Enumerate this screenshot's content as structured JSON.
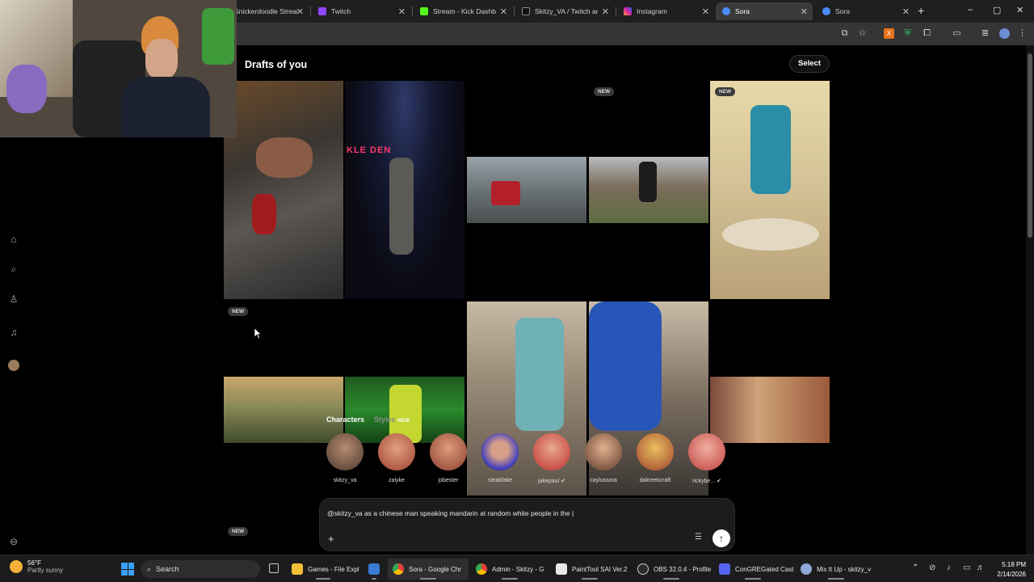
{
  "browser": {
    "tabs": [
      {
        "label": "Snickerdoodle Stream",
        "active": false
      },
      {
        "label": "Twitch",
        "active": false
      },
      {
        "label": "Stream - Kick Dashboard",
        "active": false
      },
      {
        "label": "Skitzy_VA / Twitch and",
        "active": false
      },
      {
        "label": "Instagram",
        "active": false
      },
      {
        "label": "Sora",
        "active": true
      },
      {
        "label": "Sora",
        "active": false
      }
    ],
    "new_tab": "+",
    "window_controls": [
      "–",
      "▢",
      "✕"
    ]
  },
  "sora": {
    "page_title": "Drafts of you",
    "select_label": "Select",
    "badge_new": "NEW",
    "characters_tab": "Characters",
    "styles_tab": "Styles",
    "styles_badge": "NEW",
    "characters": [
      {
        "name": "skitzy_va",
        "verified": false
      },
      {
        "name": "zaiyke",
        "verified": false
      },
      {
        "name": "jobester",
        "verified": false
      },
      {
        "name": "steakfake",
        "verified": false
      },
      {
        "name": "jakepaul",
        "verified": true
      },
      {
        "name": "cayl​ussora",
        "verified": false
      },
      {
        "name": "dakreekcraft",
        "verified": false
      },
      {
        "name": "rickybe...",
        "verified": true
      }
    ],
    "prompt_text": "@skitzy_va as a chinese man speaking mandarin at random white people in the |"
  },
  "taskbar": {
    "weather_temp": "56°F",
    "weather_desc": "Partly sunny",
    "search_label": "Search",
    "apps": [
      {
        "label": "Games - File Expl"
      },
      {
        "label": ""
      },
      {
        "label": "Sora - Google Chr"
      },
      {
        "label": "Admin - Skitzy - G"
      },
      {
        "label": "PaintTool SAI Ver.2"
      },
      {
        "label": "OBS 32.0.4 - Profile"
      },
      {
        "label": "ConGREGated Cast"
      },
      {
        "label": "Mix It Up - skitzy_v"
      }
    ],
    "time": "5:18 PM",
    "date": "2/14/2026"
  }
}
